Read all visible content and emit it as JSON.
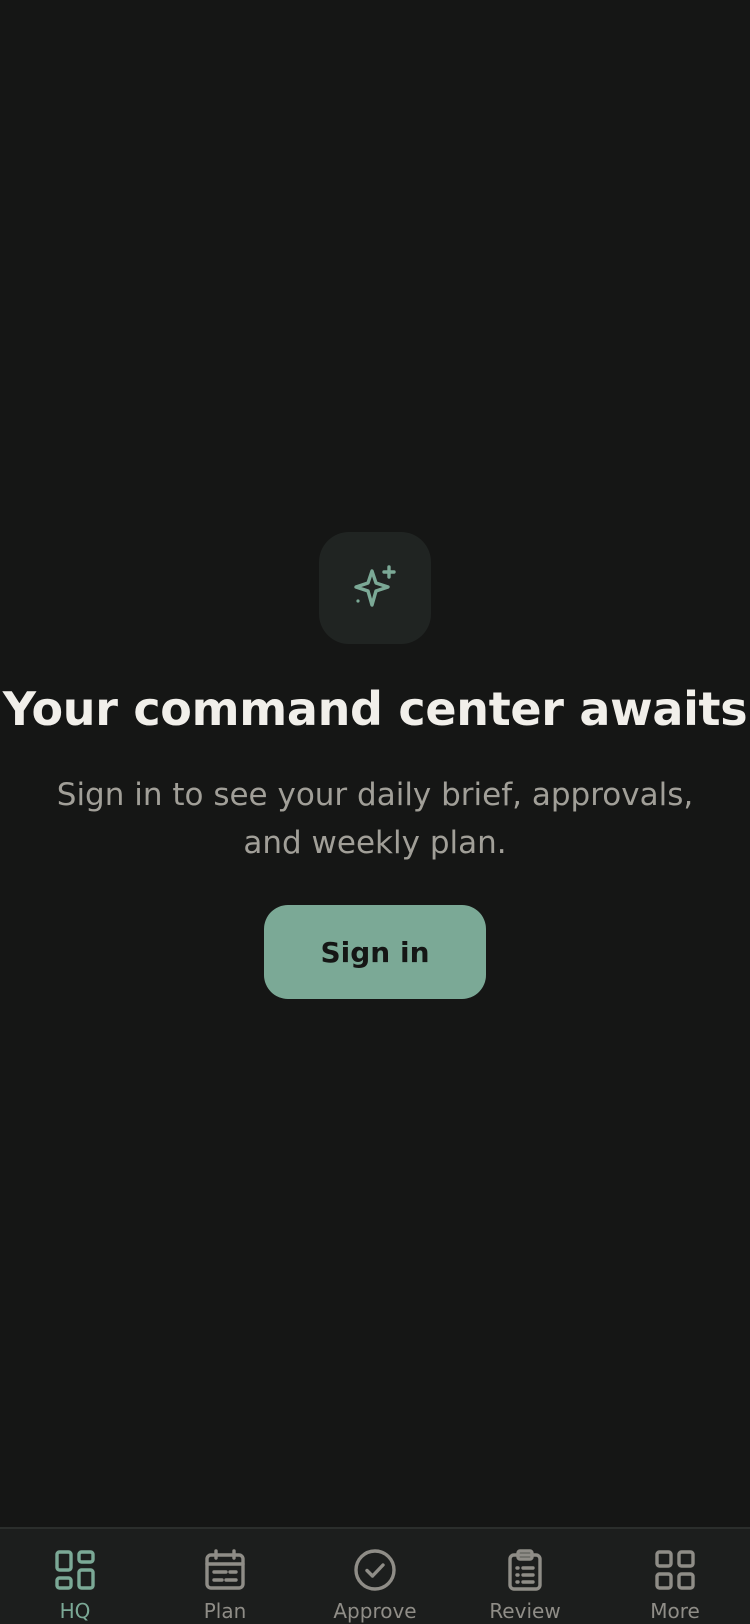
{
  "hero": {
    "icon": "sparkles-icon",
    "headline": "Your command center awaits",
    "subtitle": "Sign in to see your daily brief, approvals, and weekly plan.",
    "signin_label": "Sign in"
  },
  "tabbar": {
    "items": [
      {
        "label": "HQ",
        "icon": "dashboard-icon",
        "active": true
      },
      {
        "label": "Plan",
        "icon": "calendar-icon",
        "active": false
      },
      {
        "label": "Approve",
        "icon": "check-circle-icon",
        "active": false
      },
      {
        "label": "Review",
        "icon": "clipboard-list-icon",
        "active": false
      },
      {
        "label": "More",
        "icon": "grid-icon",
        "active": false
      }
    ]
  },
  "colors": {
    "background": "#151615",
    "accent": "#7ba996",
    "headline": "#f1efea",
    "muted": "#a19f98",
    "tab_inactive": "#8f8d87"
  }
}
